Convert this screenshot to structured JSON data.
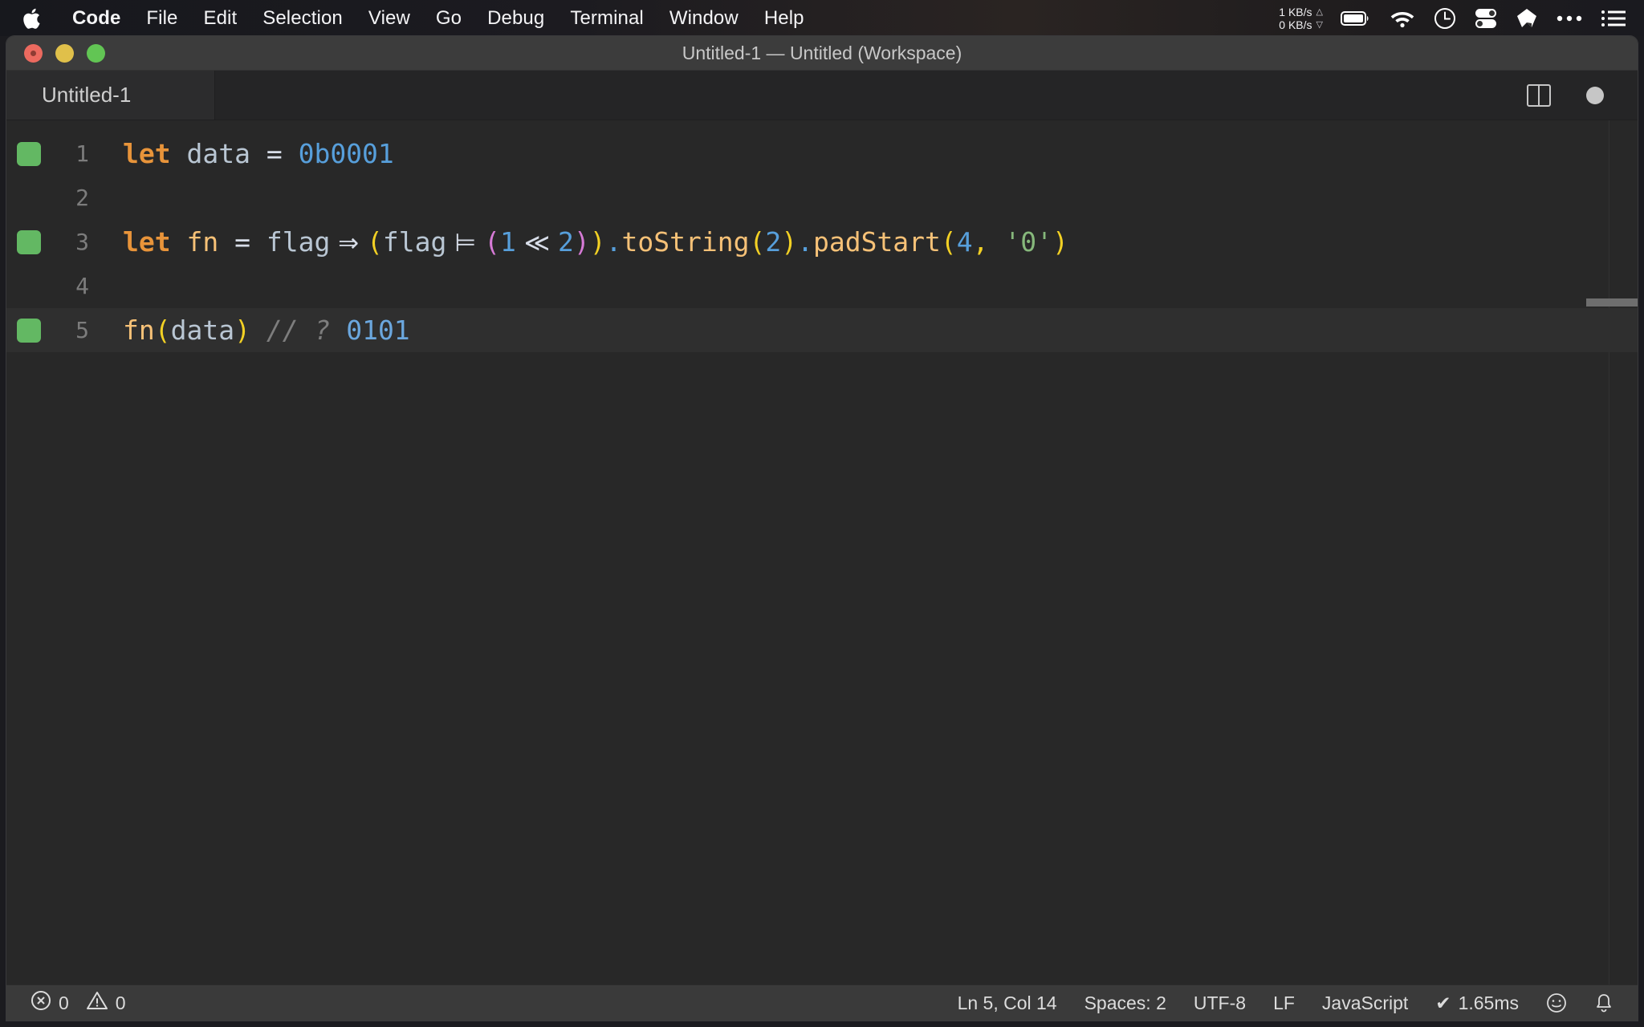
{
  "menubar": {
    "apple_icon": "apple-logo-icon",
    "items": [
      {
        "label": "Code",
        "bold": true
      },
      {
        "label": "File",
        "bold": false
      },
      {
        "label": "Edit",
        "bold": false
      },
      {
        "label": "Selection",
        "bold": false
      },
      {
        "label": "View",
        "bold": false
      },
      {
        "label": "Go",
        "bold": false
      },
      {
        "label": "Debug",
        "bold": false
      },
      {
        "label": "Terminal",
        "bold": false
      },
      {
        "label": "Window",
        "bold": false
      },
      {
        "label": "Help",
        "bold": false
      }
    ],
    "status": {
      "net_up": "1 KB/s",
      "net_down": "0 KB/s",
      "up_arrow": "△",
      "down_arrow": "▽",
      "icons": [
        "battery-icon",
        "wifi-icon",
        "clock-icon",
        "control-center-icon",
        "dropbox-icon",
        "more-icon",
        "list-icon"
      ]
    }
  },
  "window": {
    "title": "Untitled-1 — Untitled (Workspace)",
    "traffic_lights": [
      "close-button",
      "minimize-button",
      "zoom-button"
    ]
  },
  "tabbar": {
    "tabs": [
      {
        "label": "Untitled-1",
        "active": true
      }
    ],
    "actions": [
      "split-editor-icon",
      "unsaved-indicator-dot"
    ]
  },
  "editor": {
    "lines": [
      {
        "number": "1",
        "marked": true,
        "active": false
      },
      {
        "number": "2",
        "marked": false,
        "active": false
      },
      {
        "number": "3",
        "marked": true,
        "active": false
      },
      {
        "number": "4",
        "marked": false,
        "active": false
      },
      {
        "number": "5",
        "marked": true,
        "active": true
      }
    ],
    "code": {
      "l1": {
        "kw": "let",
        "sp1": " ",
        "ident": "data",
        "op": " = ",
        "num": "0b0001"
      },
      "l3": {
        "kw": "let",
        "sp1": " ",
        "fnname": "fn",
        "eq": " = ",
        "param": "flag",
        "arrow": " ⇒ ",
        "p1": "(",
        "flag2": "flag",
        "oreq": " ⊨ ",
        "p2": "(",
        "one": "1",
        "shift": " ≪ ",
        "two": "2",
        "p2c": ")",
        "p1c": ")",
        "dot1": ".",
        "tostring": "toString",
        "p3": "(",
        "two2": "2",
        "p3c": ")",
        "dot2": ".",
        "padstart": "padStart",
        "p4": "(",
        "four": "4",
        "comma": ", ",
        "zerostr": "'0'",
        "p4c": ")"
      },
      "l5": {
        "fnname": "fn",
        "p1": "(",
        "arg": "data",
        "p1c": ")",
        "comment": " // ? ",
        "result": "0101"
      }
    }
  },
  "statusbar": {
    "errors_icon": "error-circle-icon",
    "errors": "0",
    "warnings_icon": "warning-triangle-icon",
    "warnings": "0",
    "position": "Ln 5, Col 14",
    "indentation": "Spaces: 2",
    "encoding": "UTF-8",
    "eol": "LF",
    "language": "JavaScript",
    "runtime_check": "✔",
    "runtime": "1.65ms",
    "feedback_icon": "smiley-icon",
    "notifications_icon": "bell-icon"
  },
  "colors": {
    "menubar_bg": "#1c1b20",
    "titlebar_bg": "#3c3c3c",
    "editor_bg": "#282828",
    "statusbar_bg": "#3a3a3a",
    "marker_green": "#63b863",
    "keyword_orange": "#e8943a",
    "number_blue": "#579fdb",
    "bracket_yellow": "#f2d024",
    "bracket_pink": "#d67ad6",
    "string_green": "#86b87b"
  }
}
